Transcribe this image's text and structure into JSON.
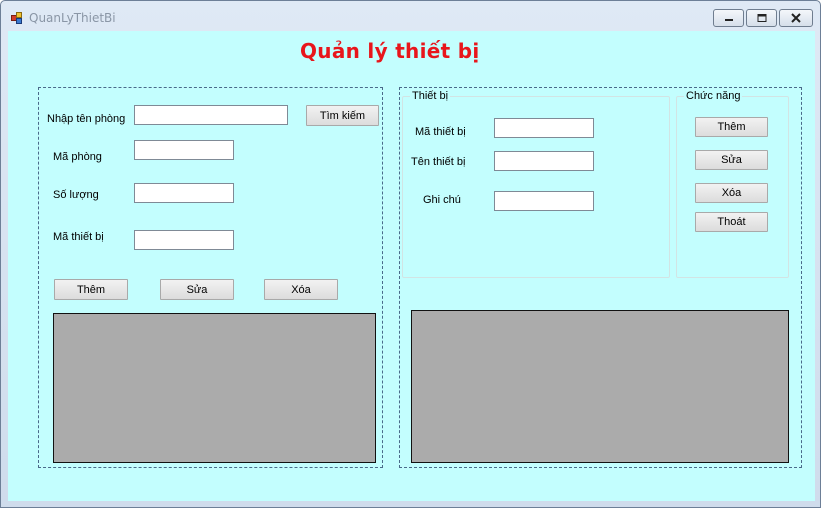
{
  "window": {
    "title": "QuanLyThietBi"
  },
  "form_title": "Quản lý thiết bị",
  "room_panel": {
    "search_label": "Nhập tên phòng",
    "search_value": "",
    "search_button": "Tìm kiếm",
    "room_code_label": "Mã phòng",
    "room_code_value": "",
    "quantity_label": "Số lượng",
    "quantity_value": "",
    "device_code_label": "Mã thiết bị",
    "device_code_value": "",
    "add_button": "Thêm",
    "edit_button": "Sửa",
    "delete_button": "Xóa"
  },
  "device_group": {
    "legend": "Thiết bị",
    "device_code_label": "Mã thiết bị",
    "device_code_value": "",
    "device_name_label": "Tên thiết bị",
    "device_name_value": "",
    "note_label": "Ghi chú",
    "note_value": ""
  },
  "function_group": {
    "legend": "Chức năng",
    "add_button": "Thêm",
    "edit_button": "Sửa",
    "delete_button": "Xóa",
    "exit_button": "Thoát"
  },
  "colors": {
    "client_background": "#c3fefe",
    "title_color": "#e8151b",
    "grid_background": "#ababab"
  },
  "icons": {
    "app": "app-icon",
    "minimize": "minimize-icon",
    "maximize": "maximize-icon",
    "close": "close-icon"
  }
}
